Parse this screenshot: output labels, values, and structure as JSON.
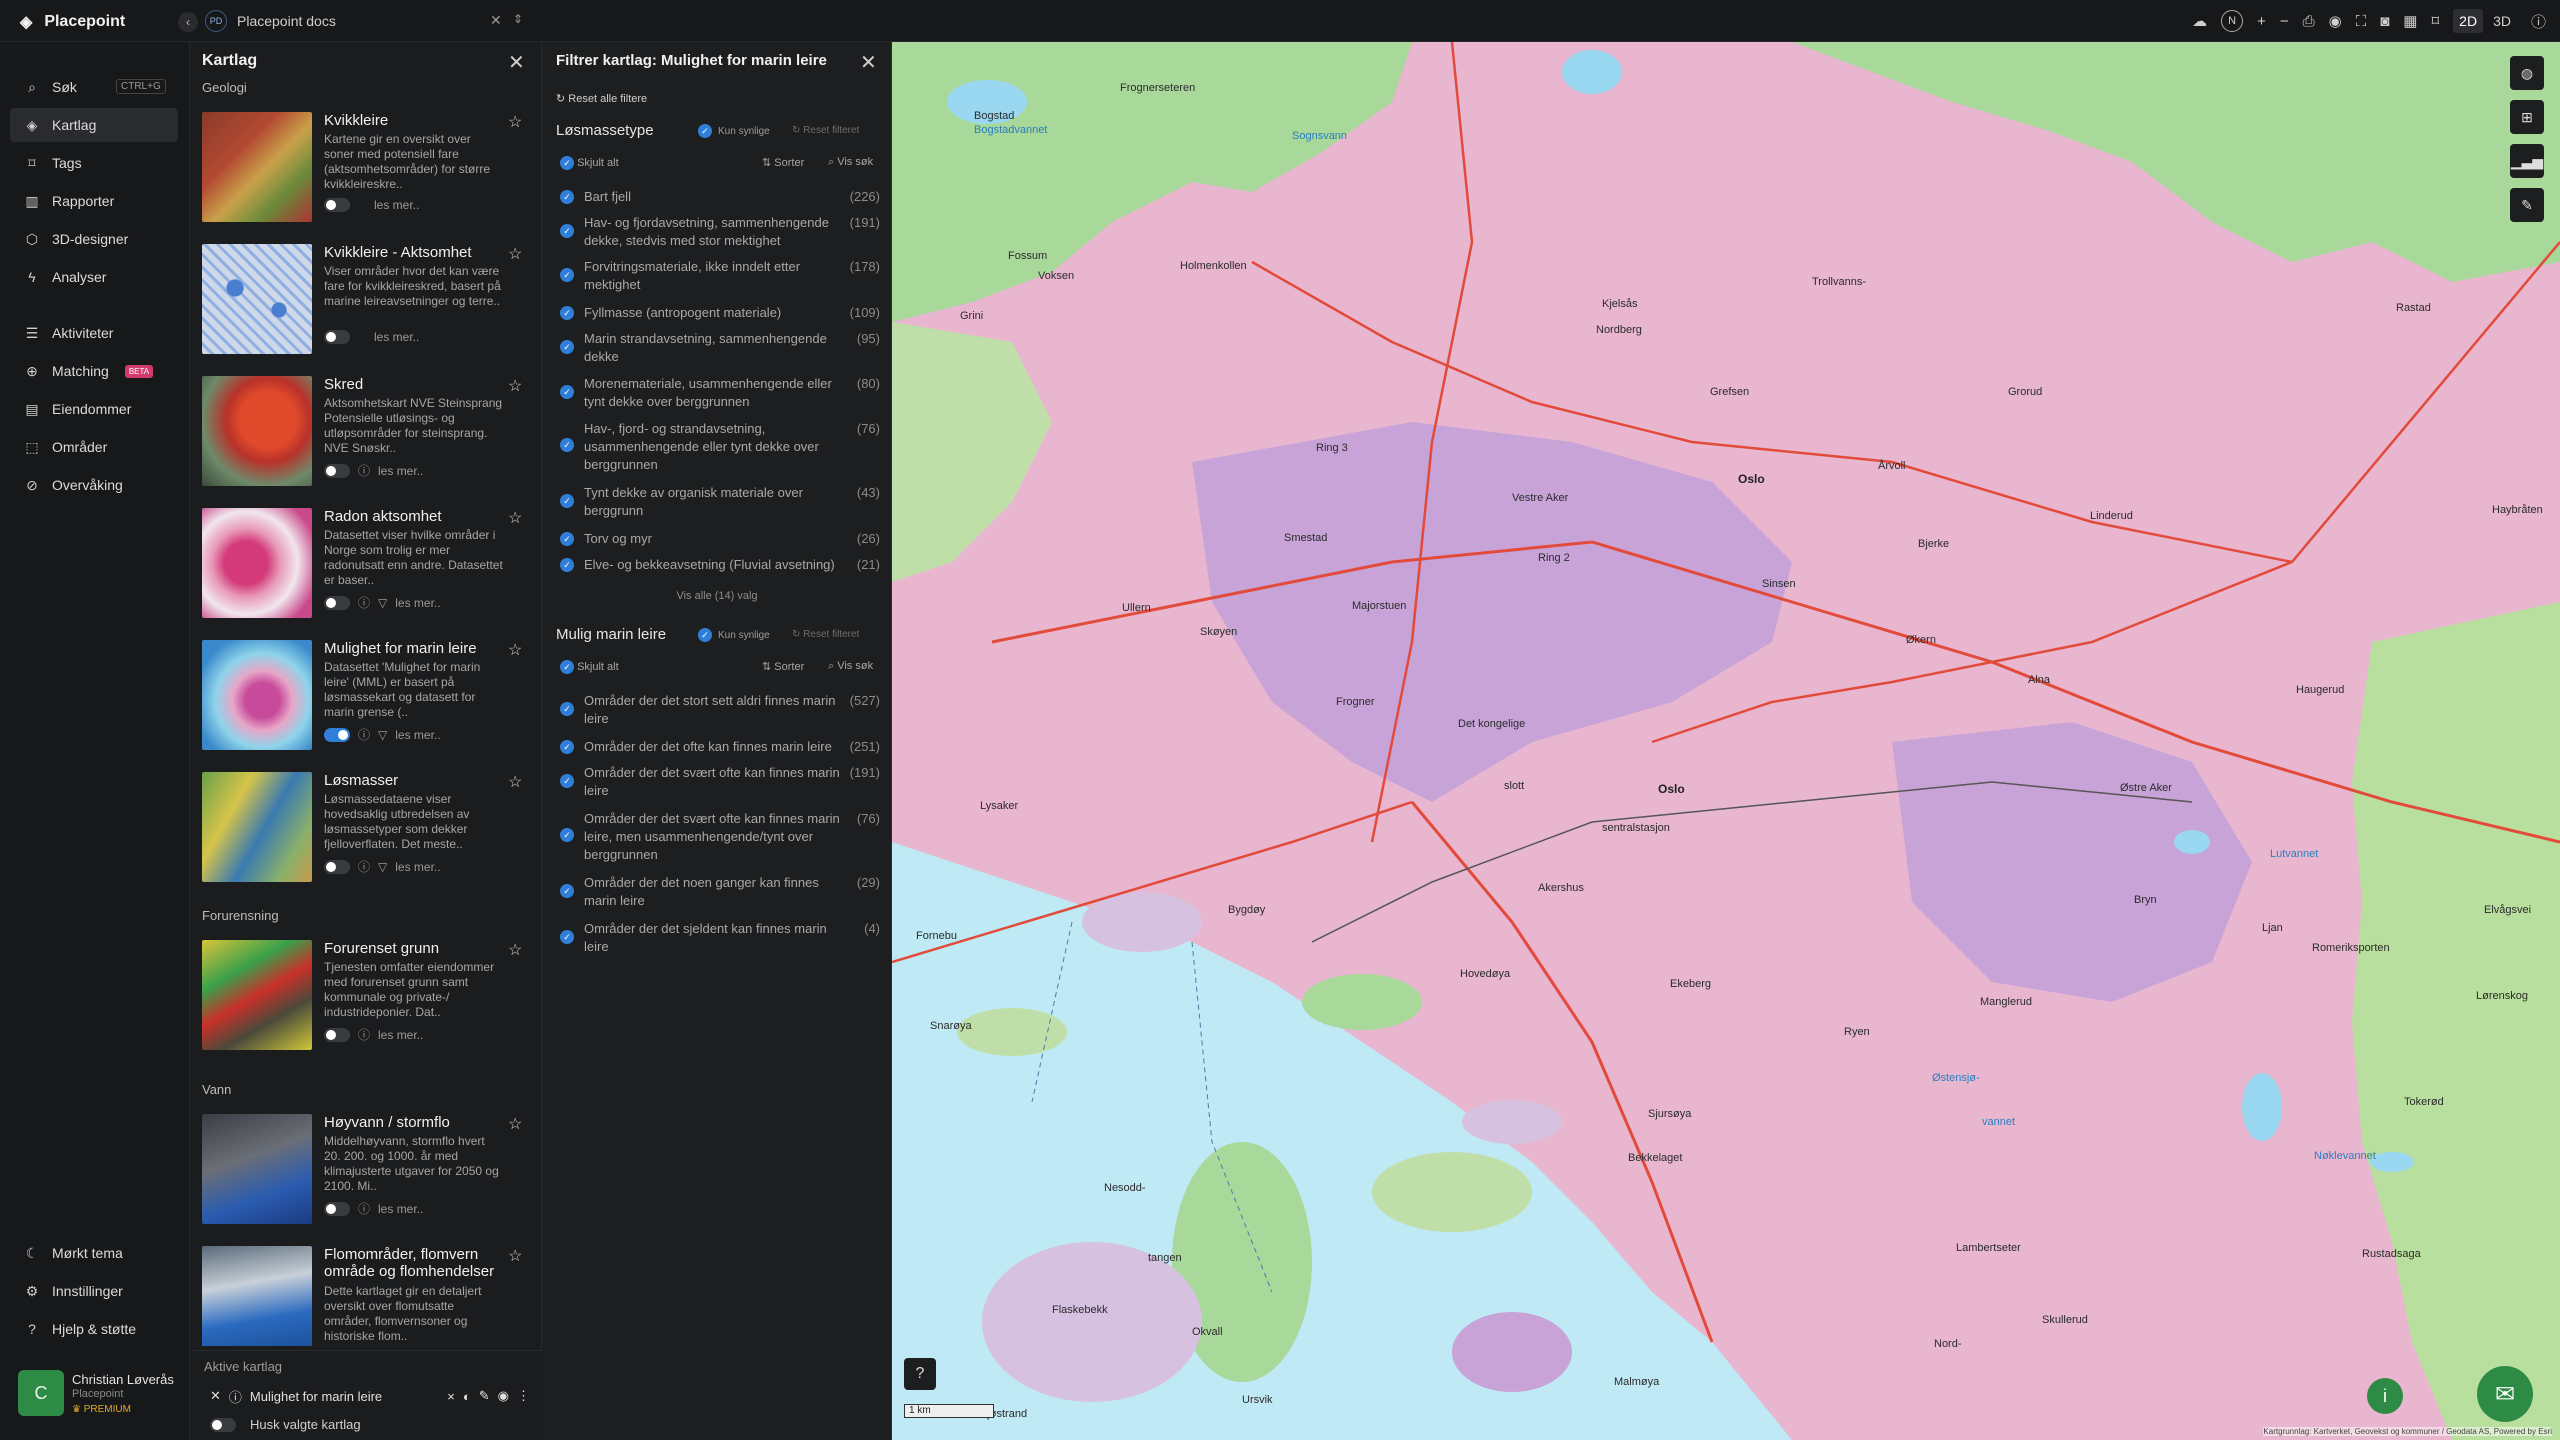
{
  "app": {
    "name": "Placepoint"
  },
  "workspace": {
    "initials": "PD",
    "name": "Placepoint docs"
  },
  "toolbar": {
    "compass": "N",
    "plus": "+",
    "minus": "−",
    "mode_2d": "2D",
    "mode_3d": "3D"
  },
  "nav": {
    "search_shortcut": "CTRL+G",
    "items": [
      {
        "label": "Søk",
        "icon": "search-icon"
      },
      {
        "label": "Kartlag",
        "icon": "layers-icon"
      },
      {
        "label": "Tags",
        "icon": "tag-icon"
      },
      {
        "label": "Rapporter",
        "icon": "report-icon"
      },
      {
        "label": "3D-designer",
        "icon": "cube-icon"
      },
      {
        "label": "Analyser",
        "icon": "analysis-icon"
      },
      {
        "label": "Aktiviteter",
        "icon": "activity-icon"
      },
      {
        "label": "Matching",
        "icon": "matching-icon",
        "badge": "BETA"
      },
      {
        "label": "Eiendommer",
        "icon": "property-icon"
      },
      {
        "label": "Områder",
        "icon": "area-icon"
      },
      {
        "label": "Overvåking",
        "icon": "monitor-icon"
      }
    ],
    "bottom": [
      {
        "label": "Mørkt tema",
        "icon": "moon-icon"
      },
      {
        "label": "Innstillinger",
        "icon": "gear-icon"
      },
      {
        "label": "Hjelp & støtte",
        "icon": "help-icon"
      }
    ]
  },
  "user": {
    "initial": "C",
    "name": "Christian Løverås",
    "org": "Placepoint",
    "plan": "PREMIUM"
  },
  "layers_panel": {
    "title": "Kartlag",
    "categories": {
      "geologi": "Geologi",
      "forurensning": "Forurensning",
      "vann": "Vann"
    },
    "more": "les mer..",
    "cards": [
      {
        "title": "Kvikkleire",
        "desc": "Kartene gir en oversikt over soner med potensiell fare (aktsomhetsområder) for større kvikkleireskre.."
      },
      {
        "title": "Kvikkleire - Aktsomhet",
        "desc": "Viser områder hvor det kan være fare for kvikkleireskred, basert på marine leireavsetninger og terre.."
      },
      {
        "title": "Skred",
        "desc": "Aktsomhetskart NVE Steinsprang Potensielle utløsings- og utløpsområder for steinsprang. NVE Snøskr.."
      },
      {
        "title": "Radon aktsomhet",
        "desc": "Datasettet viser hvilke områder i Norge som trolig er mer radonutsatt enn andre. Datasettet er baser.."
      },
      {
        "title": "Mulighet for marin leire",
        "desc": "Datasettet 'Mulighet for marin leire' (MML) er basert på løsmassekart og datasett for marin grense (.."
      },
      {
        "title": "Løsmasser",
        "desc": "Løsmassedataene viser hovedsaklig utbredelsen av løsmassetyper som dekker fjelloverflaten. Det meste.."
      },
      {
        "title": "Forurenset grunn",
        "desc": "Tjenesten omfatter eiendommer med forurenset grunn samt kommunale og private-/ industrideponier. Dat.."
      },
      {
        "title": "Høyvann / stormflo",
        "desc": "Middelhøyvann, stormflo hvert 20. 200. og 1000. år med klimajusterte utgaver for 2050 og 2100. Mi.."
      },
      {
        "title": "Flomområder, flomvern område og flomhendelser",
        "desc": "Dette kartlaget gir en detaljert oversikt over flomutsatte områder, flomvernsoner og historiske flom.."
      }
    ],
    "active_title": "Aktive kartlag",
    "active_layer": "Mulighet for marin leire",
    "remember": "Husk valgte kartlag"
  },
  "filter_panel": {
    "title": "Filtrer kartlag: Mulighet for marin leire",
    "reset_all": "Reset alle filtere",
    "only_visible": "Kun synlige",
    "reset_filter": "Reset filteret",
    "hide_all": "Skjult alt",
    "sort": "Sorter",
    "show_search": "Vis søk",
    "show_all": "Vis alle (14) valg",
    "sections": [
      {
        "title": "Løsmassetype",
        "items": [
          {
            "label": "Bart fjell",
            "count": "(226)"
          },
          {
            "label": "Hav- og fjordavsetning, sammenhengende dekke, stedvis med stor mektighet",
            "count": "(191)"
          },
          {
            "label": "Forvitringsmateriale, ikke inndelt etter mektighet",
            "count": "(178)"
          },
          {
            "label": "Fyllmasse (antropogent materiale)",
            "count": "(109)"
          },
          {
            "label": "Marin strandavsetning, sammenhengende dekke",
            "count": "(95)"
          },
          {
            "label": "Morenemateriale, usammenhengende eller tynt dekke over berggrunnen",
            "count": "(80)"
          },
          {
            "label": "Hav-, fjord- og strandavsetning, usammenhengende eller tynt dekke over berggrunnen",
            "count": "(76)"
          },
          {
            "label": "Tynt dekke av organisk materiale over berggrunn",
            "count": "(43)"
          },
          {
            "label": "Torv og myr",
            "count": "(26)"
          },
          {
            "label": "Elve- og bekkeavsetning (Fluvial avsetning)",
            "count": "(21)"
          }
        ]
      },
      {
        "title": "Mulig marin leire",
        "items": [
          {
            "label": "Områder der det stort sett aldri finnes marin leire",
            "count": "(527)"
          },
          {
            "label": "Områder der det ofte kan finnes marin leire",
            "count": "(251)"
          },
          {
            "label": "Områder der det svært ofte kan finnes marin leire",
            "count": "(191)"
          },
          {
            "label": "Områder der det svært ofte kan finnes marin leire, men usammenhengende/tynt over berggrunnen",
            "count": "(76)"
          },
          {
            "label": "Områder der det noen ganger kan finnes marin leire",
            "count": "(29)"
          },
          {
            "label": "Områder der det sjeldent kan finnes marin leire",
            "count": "(4)"
          }
        ]
      }
    ]
  },
  "map": {
    "labels": [
      "Frognerseteren",
      "Sognsvann",
      "Bogstad",
      "Bogstadvannet",
      "Holmenkollen",
      "Voksen",
      "Fossum",
      "Grini",
      "Kjelsås",
      "Trollvanns-",
      "Nordberg",
      "Grefsen",
      "Grorud",
      "Rastad",
      "Ring 3",
      "Vestre Aker",
      "Oslo",
      "Årvoll",
      "Linderud",
      "Haybråten",
      "Smestad",
      "Bjerke",
      "Sinsen",
      "Ring 2",
      "Ullern",
      "Skøyen",
      "Majorstuen",
      "Økern",
      "Frogner",
      "Det kongelige",
      "Alna",
      "Haugerud",
      "Lysaker",
      "Oslo",
      "slott",
      "sentralstasjon",
      "Østre Aker",
      "Akershus",
      "Bryn",
      "Bygdøy",
      "Fornebu",
      "Hovedøya",
      "Ekeberg",
      "Manglerud",
      "Lutvannet",
      "Lørenskog",
      "Snarøya",
      "Ryen",
      "Østensjø-",
      "vannet",
      "Sjursøya",
      "Bekkelaget",
      "Nesodd-",
      "tangen",
      "Lambertseter",
      "Nøklevannet",
      "Flaskebekk",
      "Skullerud",
      "Okvall",
      "Nord-",
      "Malmøya",
      "Ursvik",
      "Sjøstrand",
      "Romeriksporten",
      "Ljan",
      "Elvågsvei",
      "Tokerød",
      "Rustadsaga"
    ],
    "scale": "1 km",
    "attribution": "Kartgrunnlag: Kartverket, Geovekst og kommuner / Geodata AS, Powered by Esri"
  },
  "colors": {
    "accent": "#2f7fd8",
    "brand_green": "#2e8b45",
    "clay_pink": "#e8a6c8",
    "water": "#bfe9f4",
    "forest": "#a8d89a"
  }
}
